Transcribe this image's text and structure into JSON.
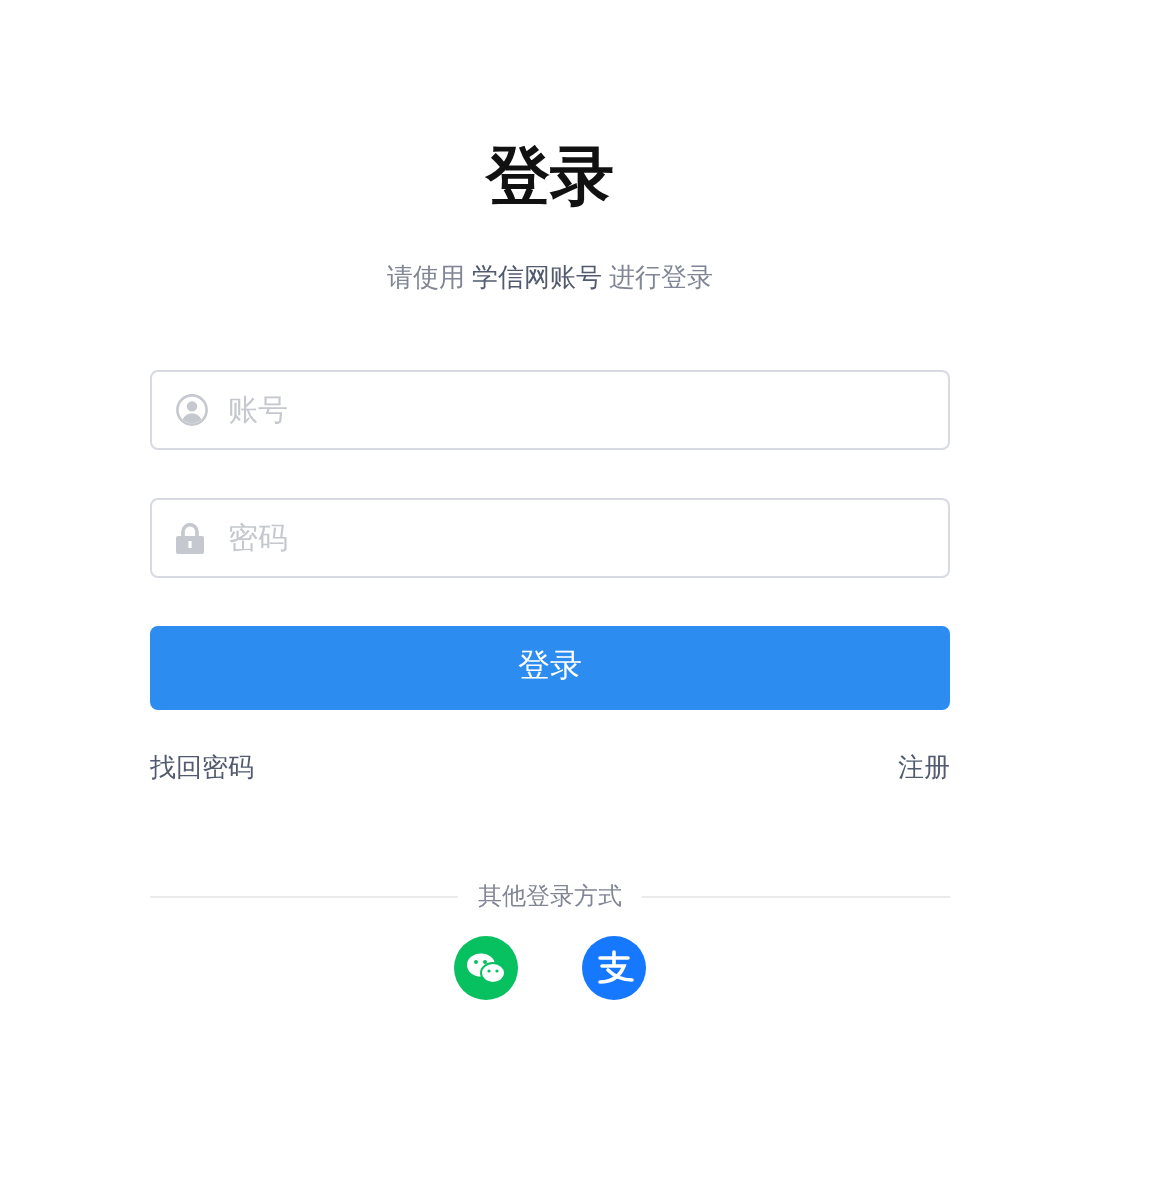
{
  "title": "登录",
  "subtitle": "请使用 **学信网账号** 进行登录",
  "fields": [
    {
      "kind": "user",
      "placeholder": "账号"
    },
    {
      "kind": "lock",
      "placeholder": "密码"
    }
  ],
  "submit": "登录",
  "links": [
    "找回密码",
    "注册"
  ],
  "other_title": "其他登录方式",
  "other_methods": [
    {
      "kind": "chat",
      "color": "#07c160"
    },
    {
      "kind": "pay",
      "color": "#1677ff"
    }
  ]
}
